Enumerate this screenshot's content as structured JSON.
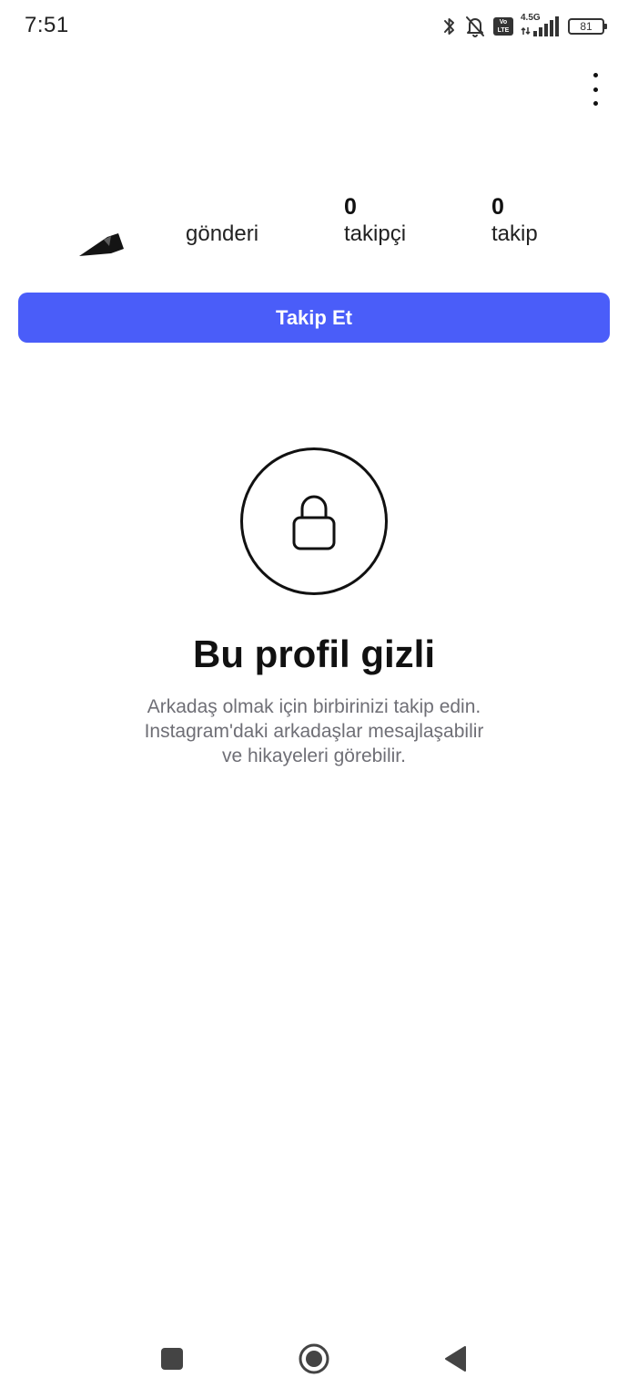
{
  "status_bar": {
    "time": "7:51",
    "volte": "Vo LTE",
    "network_type": "4.5G",
    "battery": "81",
    "icons": [
      "bluetooth-icon",
      "bell-off-icon",
      "volte-icon",
      "signal-icon",
      "battery-icon"
    ]
  },
  "profile": {
    "stats": {
      "posts_label": "gönderi",
      "followers_count": "0",
      "followers_label": "takipçi",
      "following_count": "0",
      "following_label": "takip"
    },
    "follow_button_label": "Takip Et"
  },
  "private": {
    "icon": "lock-icon",
    "title": "Bu profil gizli",
    "description_lines": [
      "Arkadaş olmak için birbirinizi takip edin.",
      "Instagram'daki arkadaşlar mesajlaşabilir",
      "ve hikayeleri görebilir."
    ]
  },
  "nav_bar": {
    "icons": [
      "recent-apps-icon",
      "home-icon",
      "back-icon"
    ]
  },
  "colors": {
    "accent": "#4a5df9",
    "text_primary": "#111111",
    "text_secondary": "#6f6f76",
    "background": "#ffffff"
  }
}
